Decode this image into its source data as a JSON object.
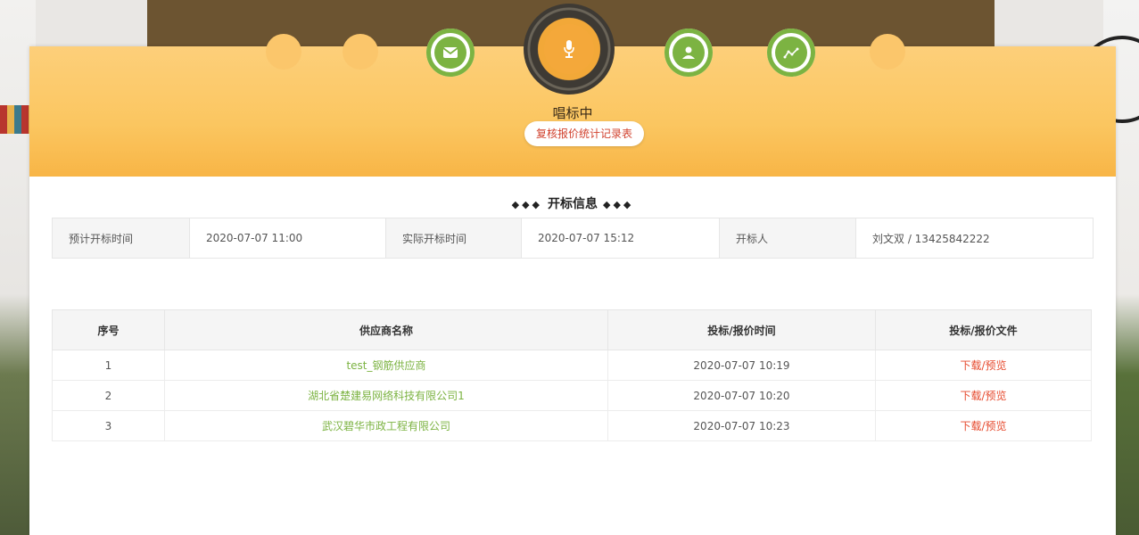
{
  "progress": {
    "steps": [
      {
        "state": "pending",
        "icon": "blank"
      },
      {
        "state": "pending",
        "icon": "blank"
      },
      {
        "state": "done",
        "icon": "envelope-icon"
      },
      {
        "state": "current",
        "icon": "microphone-icon"
      },
      {
        "state": "done",
        "icon": "user-icon"
      },
      {
        "state": "done",
        "icon": "chart-line-icon"
      },
      {
        "state": "pending",
        "icon": "blank"
      }
    ],
    "current_stage": "唱标中",
    "report_button": "复核报价统计记录表"
  },
  "opening_info": {
    "section_title": "开标信息",
    "planned_label": "预计开标时间",
    "planned_value": "2020-07-07 11:00",
    "actual_label": "实际开标时间",
    "actual_value": "2020-07-07 15:12",
    "opener_label": "开标人",
    "opener_value": "刘文双 / 13425842222"
  },
  "bids_table": {
    "headers": [
      "序号",
      "供应商名称",
      "投标/报价时间",
      "投标/报价文件"
    ],
    "rows": [
      {
        "no": "1",
        "supplier": "test_钢筋供应商",
        "time": "2020-07-07 10:19",
        "file": "下载/预览"
      },
      {
        "no": "2",
        "supplier": "湖北省楚建易网络科技有限公司1",
        "time": "2020-07-07 10:20",
        "file": "下载/预览"
      },
      {
        "no": "3",
        "supplier": "武汉碧华市政工程有限公司",
        "time": "2020-07-07 10:23",
        "file": "下载/预览"
      }
    ]
  },
  "colors": {
    "accent_orange": "#fbc660",
    "done_green": "#7cb342",
    "link_red": "#e64a2e"
  }
}
